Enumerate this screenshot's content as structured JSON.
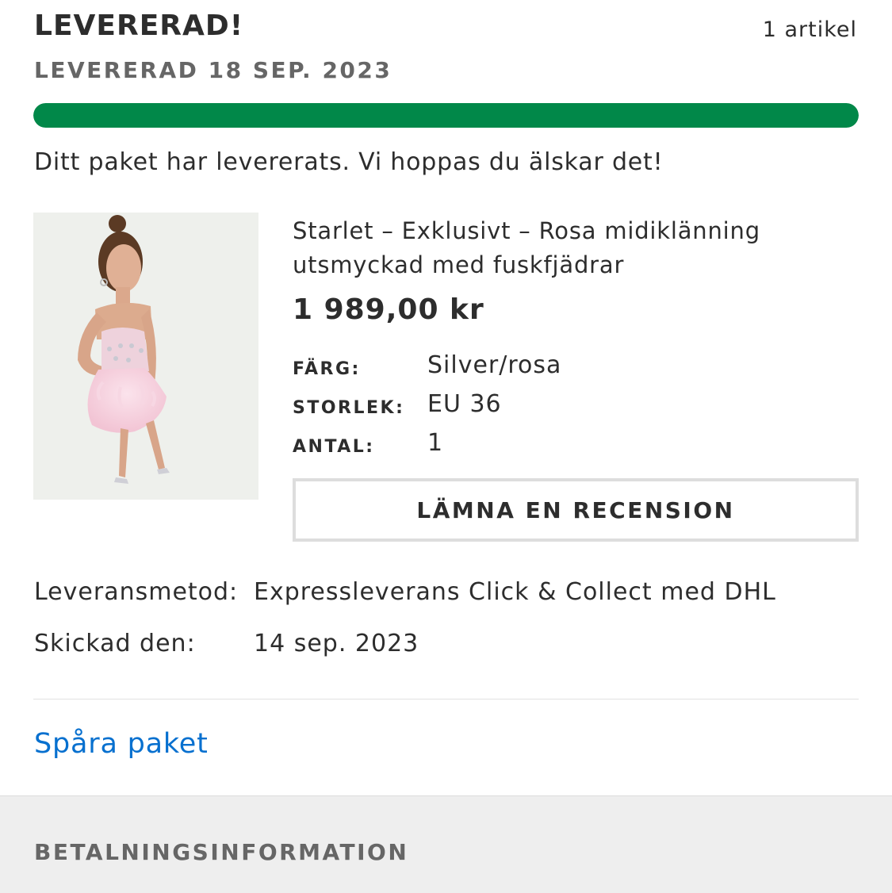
{
  "order": {
    "status_title": "LEVERERAD!",
    "item_count": "1 artikel",
    "delivered_date": "LEVERERAD 18 SEP. 2023",
    "progress_fraction": 1.0,
    "progress_color": "#018849",
    "status_message": "Ditt paket har levererats. Vi hoppas du älskar det!"
  },
  "product": {
    "image_icon": "product-photo-pink-feather-dress",
    "name": "Starlet – Exklusivt – Rosa midiklänning utsmyckad med fuskfjädrar",
    "price": "1 989,00 kr",
    "attributes": [
      {
        "label": "FÄRG:",
        "value": "Silver/rosa"
      },
      {
        "label": "STORLEK:",
        "value": "EU 36"
      },
      {
        "label": "ANTAL:",
        "value": "1"
      }
    ],
    "review_button_label": "LÄMNA EN RECENSION"
  },
  "shipping": {
    "method_label": "Leveransmetod:",
    "method_value": "Expressleverans Click & Collect med DHL",
    "sent_label": "Skickad den:",
    "sent_value": "14 sep. 2023"
  },
  "track_link_label": "Spåra paket",
  "link_color": "#0770cf",
  "payment": {
    "title": "BETALNINGSINFORMATION"
  }
}
